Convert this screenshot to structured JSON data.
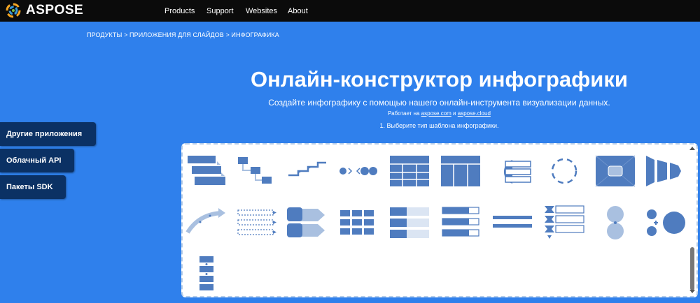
{
  "header": {
    "brand": "ASPOSE",
    "nav": [
      "Products",
      "Support",
      "Websites",
      "About"
    ]
  },
  "breadcrumb": "ПРОДУКТЫ > ПРИЛОЖЕНИЯ ДЛЯ СЛАЙДОВ > ИНФОГРАФИКА",
  "hero": {
    "title": "Онлайн-конструктор инфографики",
    "subtitle": "Создайте инфографику с помощью нашего онлайн-инструмента визуализации данных.",
    "powered_prefix": "Работает на",
    "powered_link1": "aspose.com",
    "powered_and": "и",
    "powered_link2": "aspose.cloud",
    "step": "1. Выберите тип шаблона инфографики."
  },
  "sidebar": {
    "items": [
      "Другие приложения",
      "Облачный API",
      "Пакеты SDK"
    ]
  },
  "colors": {
    "page_bg": "#2f80ec",
    "topbar": "#0b0b0b",
    "sidebar_button": "#0b3164",
    "template_blue": "#4f7cbf",
    "template_light": "#a9c0e0"
  },
  "gallery": {
    "template_icons": [
      "staircase-process-icon",
      "hierarchy-steps-icon",
      "timeline-arrows-icon",
      "converging-circles-icon",
      "grid-table-icon",
      "columns-table-icon",
      "onion-list-icon",
      "dashed-cycle-icon",
      "center-frame-icon",
      "funnel-chevrons-icon",
      "curved-arrow-icon",
      "dashed-arrow-list-icon",
      "block-arrows-icon",
      "blocks-grid-icon",
      "bar-list-icon",
      "outlined-bar-list-icon",
      "horizontal-bars-icon",
      "chevron-list-icon",
      "stacked-circles-icon",
      "circle-plus-icon",
      "vertical-flow-icon"
    ]
  }
}
